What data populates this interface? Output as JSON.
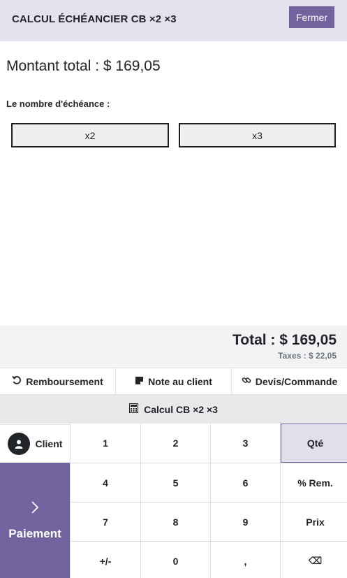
{
  "header": {
    "title": "CALCUL ÉCHÉANCIER CB ×2 ×3",
    "close_label": "Fermer"
  },
  "main": {
    "amount": "Montant total : $ 169,05",
    "count_label": "Le nombre d'échéance :",
    "options": [
      "x2",
      "x3"
    ]
  },
  "summary": {
    "total": "Total : $ 169,05",
    "taxes": "Taxes : $ 22,05"
  },
  "actions": [
    {
      "label": "Remboursement",
      "icon": "undo-icon"
    },
    {
      "label": "Note au client",
      "icon": "sticky-note-icon"
    },
    {
      "label": "Devis/Commande",
      "icon": "link-icon"
    }
  ],
  "calc_bar": {
    "label": "Calcul CB ×2 ×3",
    "icon": "calculator-icon"
  },
  "client": {
    "label": "Client",
    "icon": "user-icon"
  },
  "payment": {
    "label": "Paiement",
    "icon": "chevron-right-icon"
  },
  "keypad": {
    "keys": [
      "1",
      "2",
      "3",
      "Qté",
      "4",
      "5",
      "6",
      "% Rem.",
      "7",
      "8",
      "9",
      "Prix",
      "+/-",
      "0",
      ",",
      "⌫"
    ],
    "active_key": "Qté"
  },
  "colors": {
    "accent": "#71639e",
    "header_bg": "#e4e2ee",
    "active_key_bg": "#e1dfec"
  }
}
